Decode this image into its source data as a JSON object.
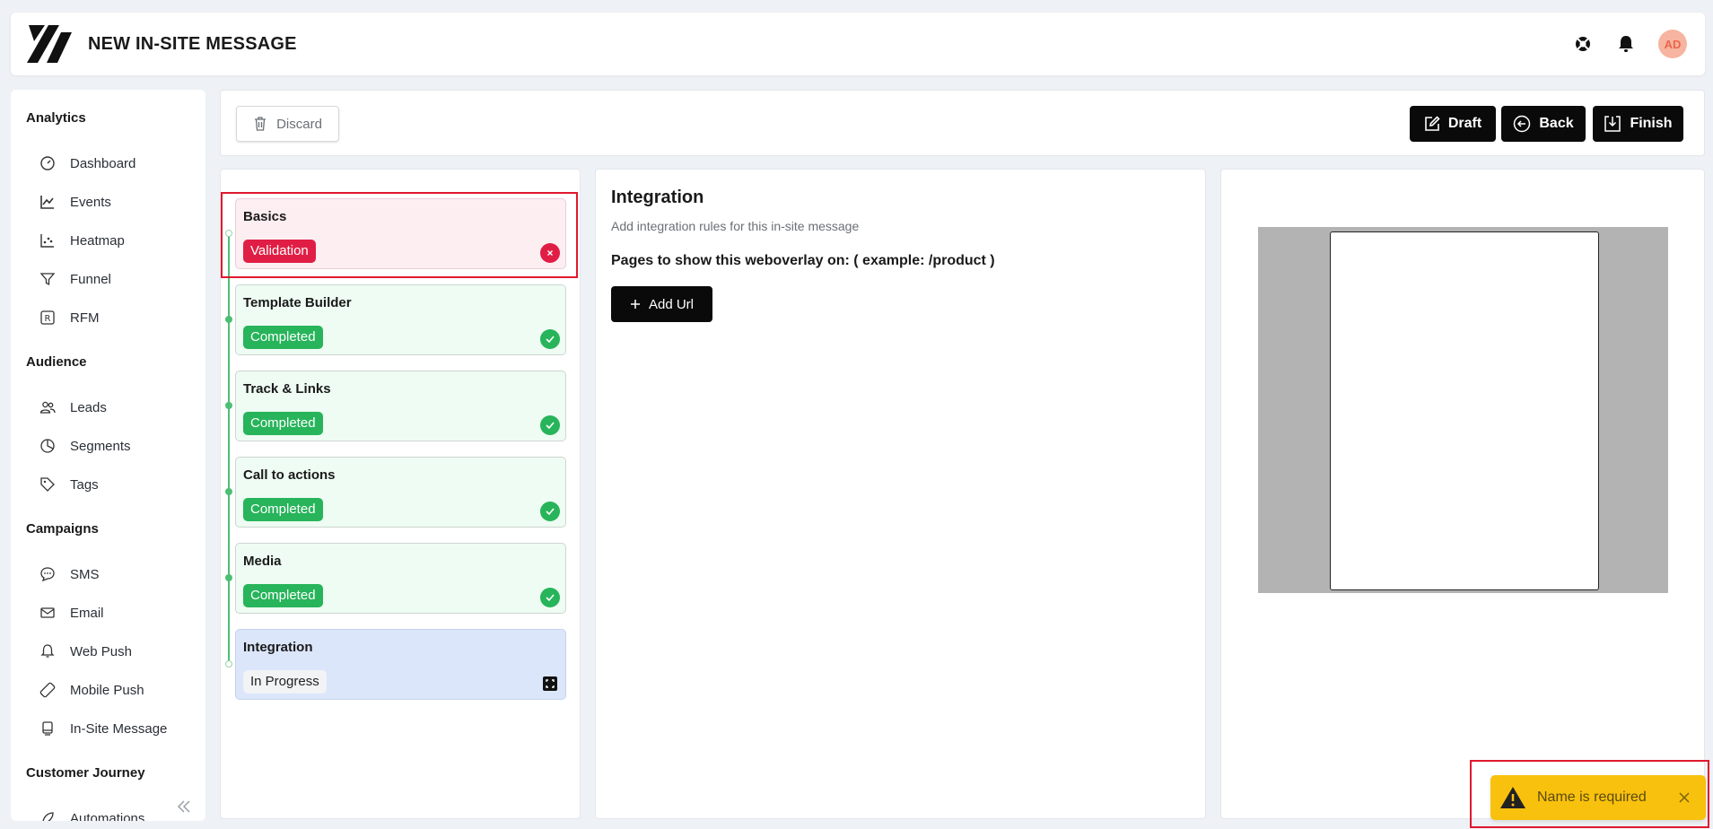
{
  "app": {
    "title": "NEW IN-SITE MESSAGE",
    "avatar_initials": "AD"
  },
  "sidebar": {
    "sections": [
      {
        "label": "Analytics",
        "items": [
          {
            "label": "Dashboard",
            "icon": "gauge-icon"
          },
          {
            "label": "Events",
            "icon": "line-chart-icon"
          },
          {
            "label": "Heatmap",
            "icon": "scatter-chart-icon"
          },
          {
            "label": "Funnel",
            "icon": "funnel-icon"
          },
          {
            "label": "RFM",
            "icon": "rfm-icon"
          }
        ]
      },
      {
        "label": "Audience",
        "items": [
          {
            "label": "Leads",
            "icon": "users-icon"
          },
          {
            "label": "Segments",
            "icon": "pie-chart-icon"
          },
          {
            "label": "Tags",
            "icon": "tag-icon"
          }
        ]
      },
      {
        "label": "Campaigns",
        "items": [
          {
            "label": "SMS",
            "icon": "chat-bubble-icon"
          },
          {
            "label": "Email",
            "icon": "envelope-icon"
          },
          {
            "label": "Web Push",
            "icon": "bell-icon"
          },
          {
            "label": "Mobile Push",
            "icon": "mobile-push-icon"
          },
          {
            "label": "In-Site Message",
            "icon": "monitor-icon"
          }
        ]
      },
      {
        "label": "Customer Journey",
        "items": [
          {
            "label": "Automations",
            "icon": "rocket-icon"
          }
        ]
      }
    ]
  },
  "actions": {
    "discard": "Discard",
    "draft": "Draft",
    "back": "Back",
    "finish": "Finish"
  },
  "steps": [
    {
      "title": "Basics",
      "status": "Validation",
      "state": "invalid"
    },
    {
      "title": "Template Builder",
      "status": "Completed",
      "state": "done"
    },
    {
      "title": "Track & Links",
      "status": "Completed",
      "state": "done"
    },
    {
      "title": "Call to actions",
      "status": "Completed",
      "state": "done"
    },
    {
      "title": "Media",
      "status": "Completed",
      "state": "done"
    },
    {
      "title": "Integration",
      "status": "In Progress",
      "state": "current"
    }
  ],
  "content": {
    "title": "Integration",
    "subtitle": "Add integration rules for this in-site message",
    "pages_label": "Pages to show this weboverlay on: ( example: /product )",
    "add_url": "Add Url"
  },
  "toast": {
    "message": "Name is required"
  },
  "colors": {
    "success": "#27b45a",
    "error": "#e01e45",
    "warning": "#f8c10e",
    "primary": "#0a0a0a"
  }
}
